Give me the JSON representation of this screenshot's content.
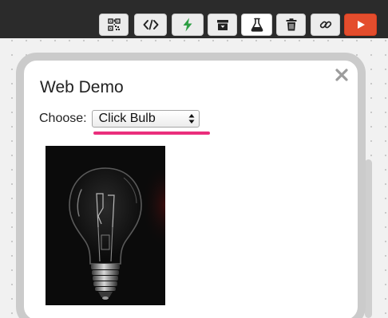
{
  "toolbar": {
    "buttons": [
      {
        "name": "qr-code-button",
        "icon": "qr-code-icon"
      },
      {
        "name": "embed-code-button",
        "icon": "code-icon"
      },
      {
        "name": "power-button",
        "icon": "lightning-icon",
        "color": "#2e9e44"
      },
      {
        "name": "archive-button",
        "icon": "archive-box-icon"
      },
      {
        "name": "lab-button",
        "icon": "flask-icon"
      },
      {
        "name": "delete-button",
        "icon": "trash-icon"
      },
      {
        "name": "link-button",
        "icon": "link-icon"
      },
      {
        "name": "run-button",
        "icon": "play-icon",
        "color": "#e44d2d"
      }
    ]
  },
  "demo": {
    "title": "Web Demo",
    "choose_label": "Choose:",
    "select_value": "Click Bulb",
    "highlight_color": "#ea2e7c",
    "image_alt": "light-bulb-photo"
  }
}
